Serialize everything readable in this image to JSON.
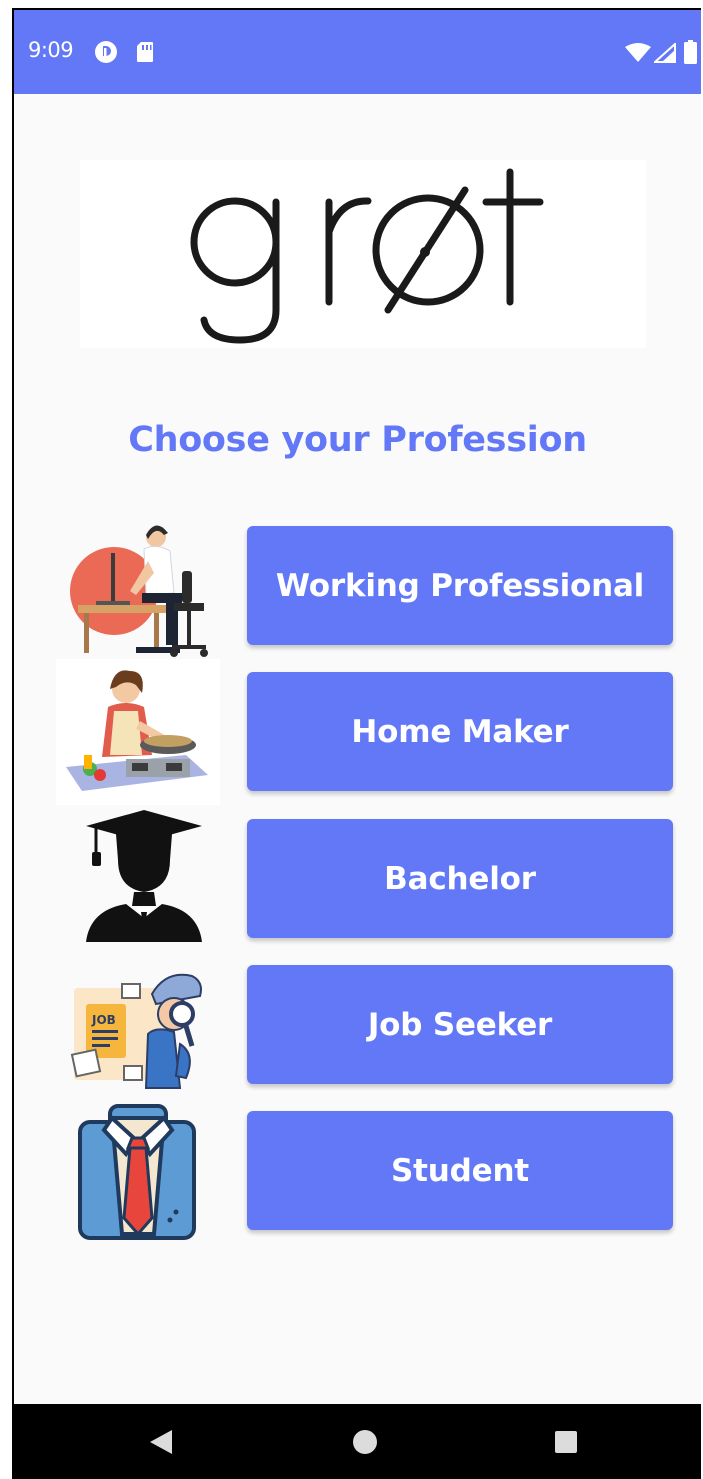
{
  "status_bar": {
    "time": "9:09",
    "icons": [
      "notification-icon",
      "sd-card-icon",
      "wifi-icon",
      "signal-icon",
      "battery-icon"
    ],
    "background": "#6278f7"
  },
  "logo": {
    "wordmark": "grøt"
  },
  "heading": "Choose your Profession",
  "accent_color": "#6278f7",
  "professions": [
    {
      "label": "Working Professional",
      "icon": "working-professional-icon"
    },
    {
      "label": "Home Maker",
      "icon": "home-maker-icon"
    },
    {
      "label": "Bachelor",
      "icon": "graduate-icon"
    },
    {
      "label": "Job Seeker",
      "icon": "job-seeker-icon"
    },
    {
      "label": "Student",
      "icon": "student-icon"
    }
  ],
  "nav_bar": {
    "icons": [
      "back-icon",
      "home-icon",
      "recents-icon"
    ]
  }
}
